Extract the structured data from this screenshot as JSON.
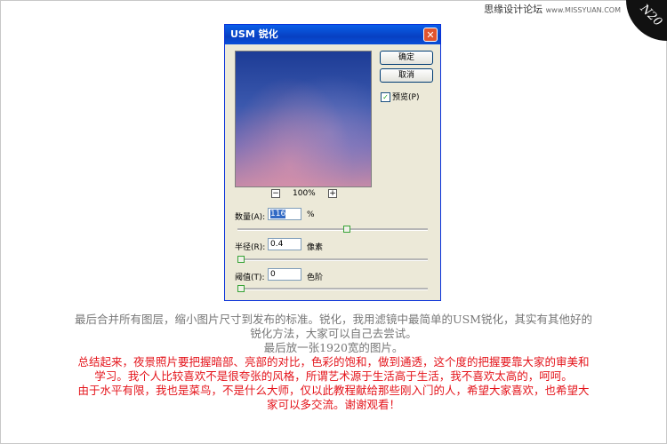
{
  "watermark": {
    "site": "思缘设计论坛",
    "url": "www.MISSYUAN.COM",
    "badge": "N20"
  },
  "dialog": {
    "title": "USM 锐化",
    "close_glyph": "✕",
    "ok_label": "确定",
    "cancel_label": "取消",
    "preview_label": "预览(P)",
    "preview_checked": true,
    "zoom_out": "−",
    "zoom_in": "+",
    "zoom_level": "100%",
    "amount": {
      "label": "数量(A):",
      "value": "116",
      "unit": "%",
      "slider_fraction": 0.58
    },
    "radius": {
      "label": "半径(R):",
      "value": "0.4",
      "unit": "像素",
      "slider_fraction": 0.0
    },
    "threshold": {
      "label": "阈值(T):",
      "value": "0",
      "unit": "色阶",
      "slider_fraction": 0.0
    }
  },
  "captions": {
    "line1": "最后合并所有图层，缩小图片尺寸到发布的标准。锐化，我用滤镜中最简单的USM锐化，其实有其他好的",
    "line2": "锐化方法，大家可以自己去尝试。",
    "line3": "最后放一张1920宽的图片。",
    "line4": "总结起来，夜景照片要把握暗部、亮部的对比，色彩的饱和，做到通透，这个度的把握要靠大家的审美和",
    "line5": "学习。我个人比较喜欢不是很夸张的风格，所谓艺术源于生活高于生活，我不喜欢太高的，呵呵。",
    "line6": "由于水平有限，我也是菜鸟，不是什么大师，仅以此教程献给那些刚入门的人，希望大家喜欢，也希望大",
    "line7": "家可以多交流。谢谢观看！"
  },
  "colors": {
    "caption_gray": "#777777",
    "caption_red": "#e4141b",
    "titlebar": "#0a5fe8"
  }
}
